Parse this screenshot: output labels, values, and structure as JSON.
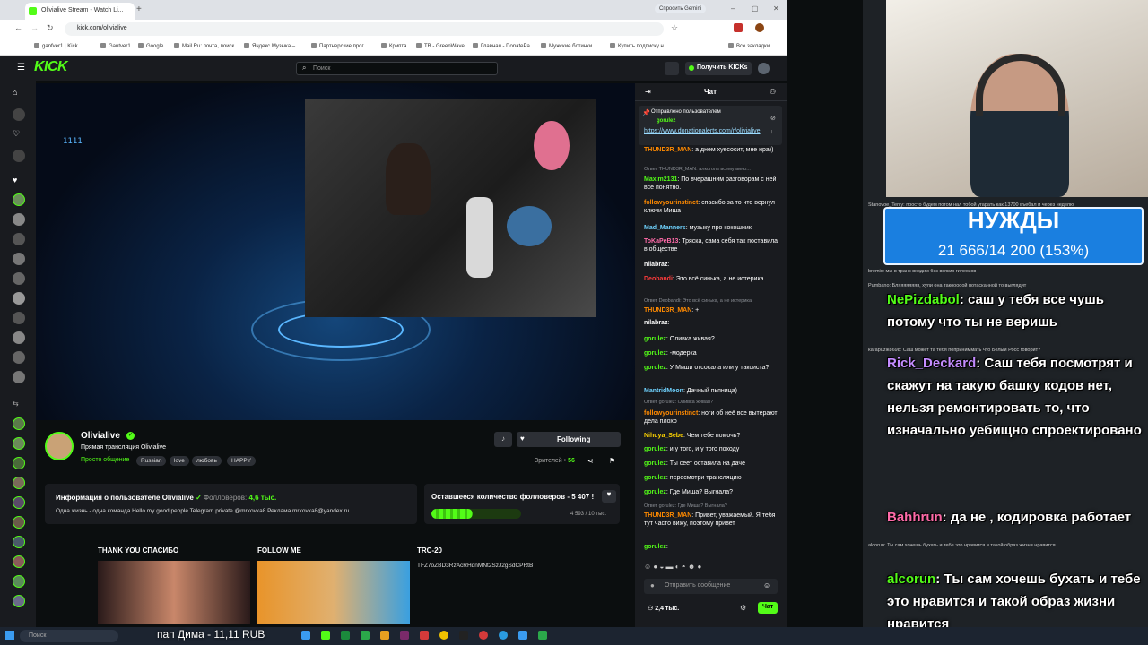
{
  "browser": {
    "tab_title": "Olivialive Stream - Watch Li...",
    "url": "kick.com/olivialive",
    "gemini": "Спросить Gemini",
    "bookmarks": [
      "ganfver1 | Kick",
      "Google",
      "Gantver1",
      "Mail.Ru: почта, поиск...",
      "Яндекс Музыка – ...",
      "Партнерские прог...",
      "Крипта",
      "TB - GreenWave",
      "Главная - DonatePa...",
      "Мужские ботинки...",
      "Купить подписку н...",
      "Все закладки"
    ]
  },
  "kick": {
    "logo": "KICK",
    "search_placeholder": "Поиск",
    "get_kicks": "Получить KICKs"
  },
  "streamer": {
    "name": "Olivialive",
    "title": "Прямая трансляция Olivialive",
    "category": "Просто общение",
    "tags": [
      "Russian",
      "love",
      "любовь",
      "HAPPY"
    ],
    "follow_label": "Following",
    "viewers_label": "Зрителей •",
    "viewers_count": "56"
  },
  "about": {
    "heading": "Информация о пользователе Olivialive",
    "followers_label": "Фолловеров:",
    "followers_value": "4,6 тыс.",
    "bio": "Одна жизнь - одна команда Hello my good people   Telegram private @mrkovka8 Реклама mrkovka8@yandex.ru"
  },
  "goal": {
    "heading": "Оставшееся количество фолловеров - 5 407 !",
    "current": "4 593 / 10 тыс.",
    "progress": 0.46
  },
  "panels": [
    {
      "title": "THANK YOU СПАСИБО"
    },
    {
      "title": "FOLLOW ME"
    },
    {
      "title": "TRC-20",
      "text": "TFZ7oZBD3RzAcRHqnMNt2SzJ2gSdCPRtB"
    }
  ],
  "chat": {
    "header": "Чат",
    "pinned_label": "Отправлено пользователем",
    "pinned_user": "gorulez",
    "pinned_link": "https://www.donationalerts.com/r/olivialive",
    "messages": [
      {
        "user": "THUND3R_MAN",
        "color": "#ff8a00",
        "text": ": а днем хуесосит, мне нра))"
      },
      {
        "reply": "Ответ THUND3R_MAN: алкоголь всему вино..."
      },
      {
        "user": "Maxim2131",
        "color": "#53fc18",
        "text": ": По вчерашним разговорам с ней всё понятно."
      },
      {
        "user": "followyourinstinct",
        "color": "#ff8a00",
        "text": ": спасибо за то что вернул ключи Миша"
      },
      {
        "user": "Mad_Manners",
        "color": "#6fd3ff",
        "text": ": музыку про кокошник"
      },
      {
        "user": "ToKaPeB13",
        "color": "#ff6aa8",
        "text": ": Тряска, сама себя так поставила в обществе"
      },
      {
        "user": "nilabraz",
        "color": "#ffffff",
        "text": ":"
      },
      {
        "user": "Deobandi",
        "color": "#ff3b3b",
        "text": ": Это всё синька, а не истерика"
      },
      {
        "reply": "Ответ Deobandi: Это всё синька, а не истерика"
      },
      {
        "user": "THUND3R_MAN",
        "color": "#ff8a00",
        "text": ": +"
      },
      {
        "user": "nilabraz",
        "color": "#ffffff",
        "text": ":"
      },
      {
        "user": "gorulez",
        "color": "#53fc18",
        "text": ": Оливка живая?"
      },
      {
        "user": "gorulez",
        "color": "#53fc18",
        "text": ": -модерка"
      },
      {
        "user": "gorulez",
        "color": "#53fc18",
        "text": ": У Миши отсосала или у таксиста?"
      },
      {
        "user": "MantridMoon",
        "color": "#6fd3ff",
        "text": ": Дачный пьяница)"
      },
      {
        "reply": "Ответ gorulez: Оливка живая?"
      },
      {
        "user": "followyourinstinct",
        "color": "#ff8a00",
        "text": ": ноги об неё все вытерают дела плохо"
      },
      {
        "user": "Nihuya_Sebe",
        "color": "#ffd400",
        "text": ": Чем тебе помочь?"
      },
      {
        "user": "gorulez",
        "color": "#53fc18",
        "text": ": и у того, и у того походу"
      },
      {
        "user": "gorulez",
        "color": "#53fc18",
        "text": ": Ты сеет оставила на даче"
      },
      {
        "user": "gorulez",
        "color": "#53fc18",
        "text": ": пересмотри трансляцию"
      },
      {
        "user": "gorulez",
        "color": "#53fc18",
        "text": ": Где Миша? Выгнала?"
      },
      {
        "reply": "Ответ gorulez: Где Миша? Выгнала?"
      },
      {
        "user": "THUND3R_MAN",
        "color": "#ff8a00",
        "text": ": Привет, уважаемый. Я тебя тут часто вижу, поэтому привет"
      },
      {
        "user": "gorulez",
        "color": "#53fc18",
        "text": ":"
      }
    ],
    "input_placeholder": "Отправить сообщение",
    "viewer_count": "2,4 тыс.",
    "chat_button": "Чат"
  },
  "overlay": {
    "goal_title": "НУЖДЫ",
    "goal_value": "21 666/14 200 (153%)",
    "big_messages": [
      {
        "user": "NePizdabol",
        "text": ": саш у тебя все чушь потому что ты не веришь"
      },
      {
        "user": "Rick_Deckard",
        "text": ": Саш тебя посмотрят и скажут на такую башку кодов нет, нельзя ремонтировать то, что изначально уебищно спроектировано"
      },
      {
        "user": "Bahhrun",
        "text": ": да не , кодировка работает"
      },
      {
        "user": "alcorun",
        "text": ": Ты сам хочешь бухать и тебе это нравится и такой образ жизни нравится"
      }
    ],
    "small_lines": [
      "Stanovoe_Tenjy: просто будем потом нал тобой угарать как 13700 въебал и через неделю",
      "bremix: мы в транс входим без всяких гипеозов",
      "Pumbano: Бляяяяяяяя, хули она такооооой потасканной то выглядит",
      "karapuzik8698: Саш может та тебя поприниммать что Белый Росс говорит?",
      "alcorun: Ты сам хочешь бухать и тебе это нравится и такой образ жизни нравится"
    ]
  },
  "taskbar": {
    "search": "Поиск",
    "news": "пап Дима - 11,11 RUB"
  }
}
